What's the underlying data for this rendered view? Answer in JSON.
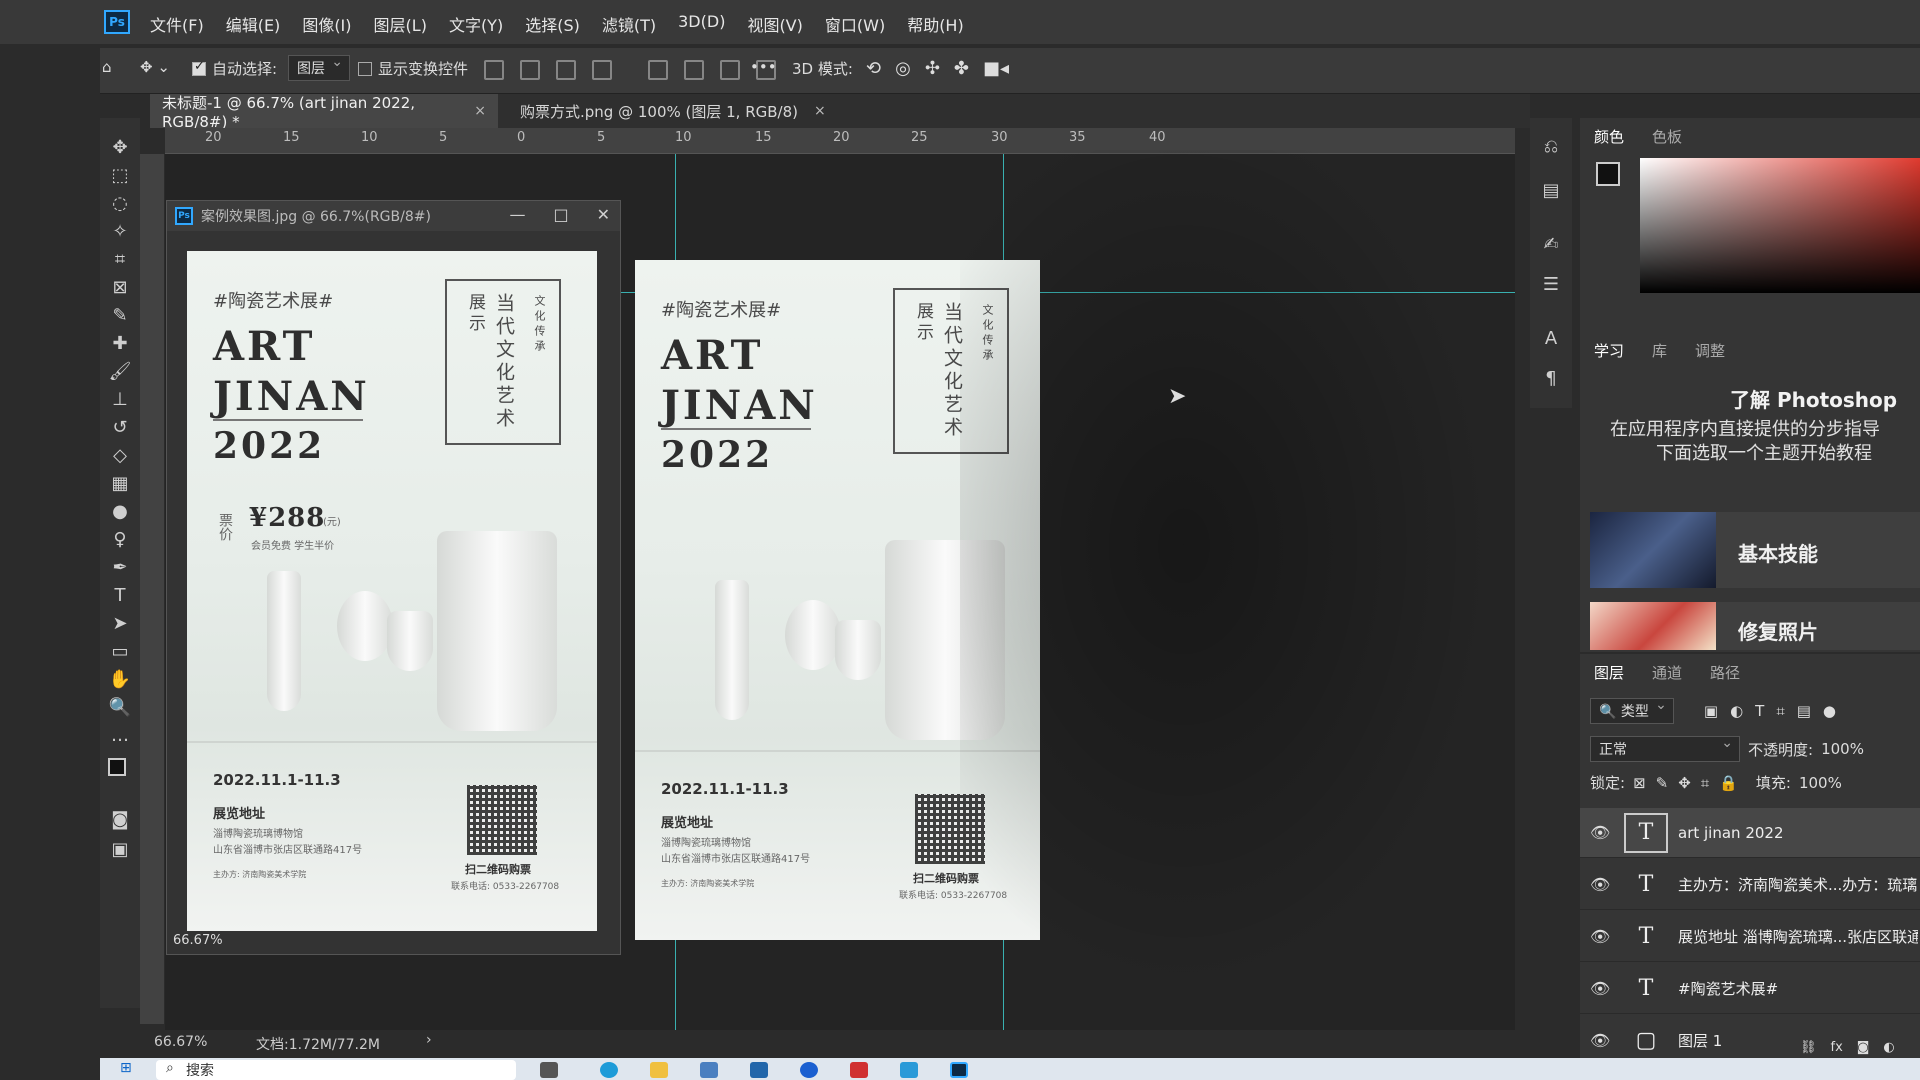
{
  "menu": {
    "logo": "Ps",
    "items": [
      "文件(F)",
      "编辑(E)",
      "图像(I)",
      "图层(L)",
      "文字(Y)",
      "选择(S)",
      "滤镜(T)",
      "3D(D)",
      "视图(V)",
      "窗口(W)",
      "帮助(H)"
    ]
  },
  "options": {
    "auto_select_label": "自动选择:",
    "auto_select_value": "图层",
    "show_transform_label": "显示变换控件",
    "more": "•••",
    "mode_3d_label": "3D 模式:"
  },
  "tabs": [
    {
      "label": "未标题-1 @ 66.7% (art jinan 2022, RGB/8#) *",
      "close": "×"
    },
    {
      "label": "购票方式.png @ 100% (图层 1, RGB/8)",
      "close": "×"
    }
  ],
  "ruler": {
    "labels": [
      "20",
      "15",
      "10",
      "5",
      "0",
      "5",
      "10",
      "15",
      "20",
      "25",
      "30",
      "35",
      "40"
    ]
  },
  "float_window": {
    "title": "案例效果图.jpg @ 66.7%(RGB/8#)",
    "zoom": "66.67%"
  },
  "poster": {
    "tag": "#陶瓷艺术展#",
    "line1": "ART",
    "line2": "JINAN",
    "line3": "2022",
    "v_main": "当代文化艺术",
    "v_side": "展示",
    "v_small": "文化传承",
    "price_label": "票价",
    "price": "¥288",
    "price_unit": "(元)",
    "price_note": "会员免费 学生半价",
    "date": "2022.11.1-11.3",
    "addr_heading": "展览地址",
    "addr_line1": "淄博陶瓷琉璃博物馆",
    "addr_line2": "山东省淄博市张店区联通路417号",
    "organizer": "主办方: 济南陶瓷美术学院",
    "qr_caption": "扫二维码购票",
    "phone": "联系电话: 0533-2267708"
  },
  "panels": {
    "color_tabs": [
      "颜色",
      "色板"
    ],
    "learn_tabs": [
      "学习",
      "库",
      "调整"
    ],
    "learn_title": "了解 Photoshop",
    "learn_desc1": "在应用程序内直接提供的分步指导",
    "learn_desc2": "下面选取一个主题开始教程",
    "cards": [
      "基本技能",
      "修复照片"
    ],
    "layer_tabs": [
      "图层",
      "通道",
      "路径"
    ],
    "filter_label": "类型",
    "blend_mode": "正常",
    "opacity_label": "不透明度:",
    "opacity_value": "100%",
    "lock_label": "锁定:",
    "fill_label": "填充:",
    "fill_value": "100%",
    "layers": [
      {
        "name": "art jinan 2022"
      },
      {
        "name": "主办方：济南陶瓷美术...办方：琉璃"
      },
      {
        "name": "展览地址  淄博陶瓷琉璃...张店区联通"
      },
      {
        "name": "#陶瓷艺术展#"
      },
      {
        "name": "图层 1"
      }
    ],
    "fx": "fx"
  },
  "status": {
    "zoom": "66.67%",
    "doc": "文档:1.72M/77.2M",
    "arrow": "›"
  },
  "taskbar": {
    "search_placeholder": "搜索"
  },
  "colors": {
    "accent": "#31a8ff",
    "guide": "#3fd3d3",
    "panel_bg": "#353535"
  }
}
